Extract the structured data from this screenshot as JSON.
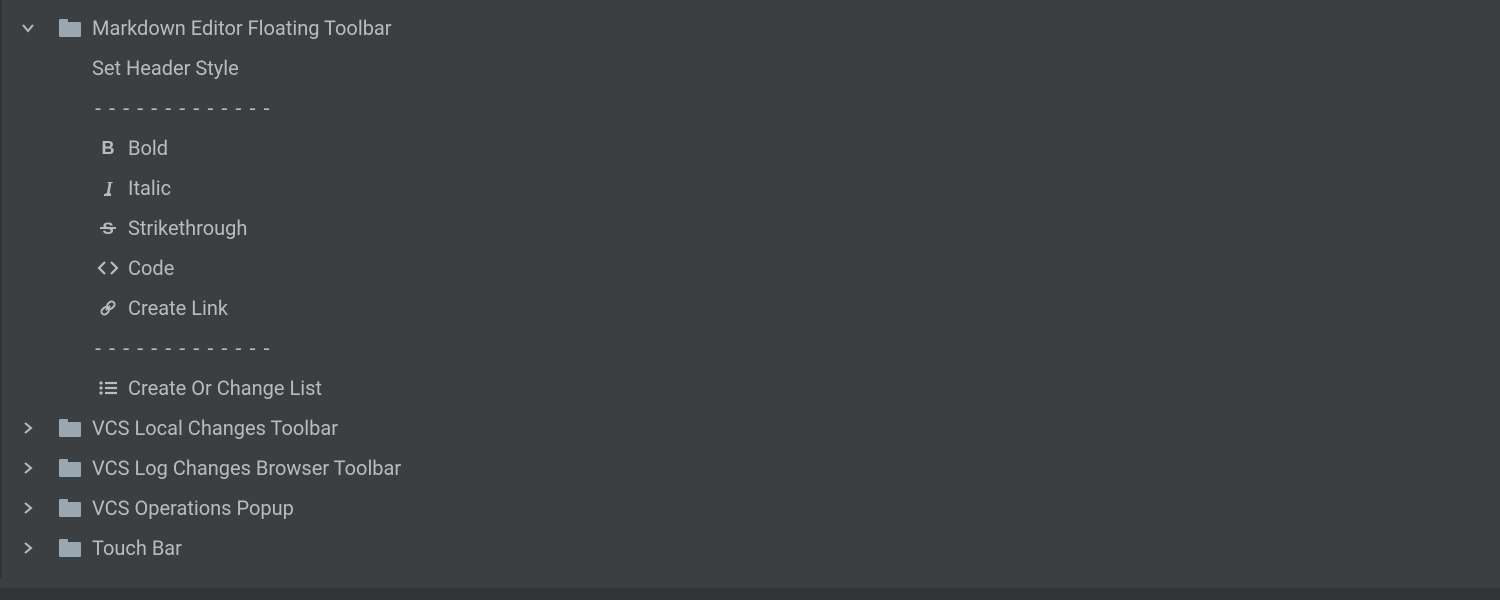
{
  "tree": {
    "expanded": {
      "label": "Markdown Editor Floating Toolbar",
      "children": {
        "set_header": "Set Header Style",
        "sep1": "-------------",
        "bold": "Bold",
        "italic": "Italic",
        "strike": "Strikethrough",
        "code": "Code",
        "link": "Create Link",
        "sep2": "-------------",
        "list": "Create Or Change List"
      }
    },
    "vcs_local": "VCS Local Changes Toolbar",
    "vcs_log": "VCS Log Changes Browser Toolbar",
    "vcs_ops": "VCS Operations Popup",
    "touch_bar": "Touch Bar"
  }
}
